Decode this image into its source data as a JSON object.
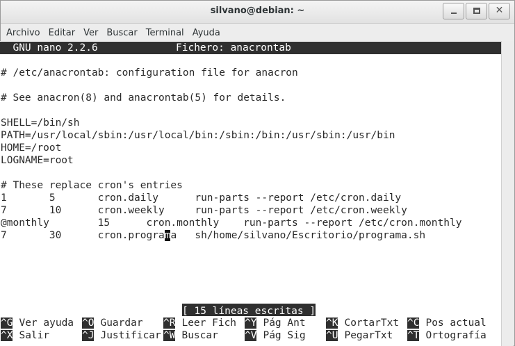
{
  "window": {
    "title": "silvano@debian: ~"
  },
  "menu": [
    "Archivo",
    "Editar",
    "Ver",
    "Buscar",
    "Terminal",
    "Ayuda"
  ],
  "nano": {
    "version": "  GNU nano 2.2.6",
    "file": "Fichero: anacrontab"
  },
  "lines": [
    "# /etc/anacrontab: configuration file for anacron",
    "",
    "# See anacron(8) and anacrontab(5) for details.",
    "",
    "SHELL=/bin/sh",
    "PATH=/usr/local/sbin:/usr/local/bin:/sbin:/bin:/usr/sbin:/usr/bin",
    "HOME=/root",
    "LOGNAME=root",
    "",
    "# These replace cron's entries",
    "1       5       cron.daily      run-parts --report /etc/cron.daily",
    "7       10      cron.weekly     run-parts --report /etc/cron.weekly",
    "@monthly        15      cron.monthly    run-parts --report /etc/cron.monthly"
  ],
  "cursor_line": {
    "before": "7       30      cron.progra",
    "cursor_char": "m",
    "after": "a   sh/home/silvano/Escritorio/programa.sh"
  },
  "status": "[ 15 líneas escritas ]",
  "shortcuts": [
    {
      "key": "^G",
      "label": "Ver ayuda"
    },
    {
      "key": "^O",
      "label": "Guardar"
    },
    {
      "key": "^R",
      "label": "Leer Fich"
    },
    {
      "key": "^Y",
      "label": "Pág Ant"
    },
    {
      "key": "^K",
      "label": "CortarTxt"
    },
    {
      "key": "^C",
      "label": "Pos actual"
    },
    {
      "key": "^X",
      "label": "Salir"
    },
    {
      "key": "^J",
      "label": "Justificar"
    },
    {
      "key": "^W",
      "label": "Buscar"
    },
    {
      "key": "^V",
      "label": "Pág Sig"
    },
    {
      "key": "^U",
      "label": "PegarTxt"
    },
    {
      "key": "^T",
      "label": "Ortografía"
    }
  ],
  "icons": {
    "minimize": "minimize-icon",
    "maximize": "maximize-icon",
    "close": "close-icon"
  }
}
